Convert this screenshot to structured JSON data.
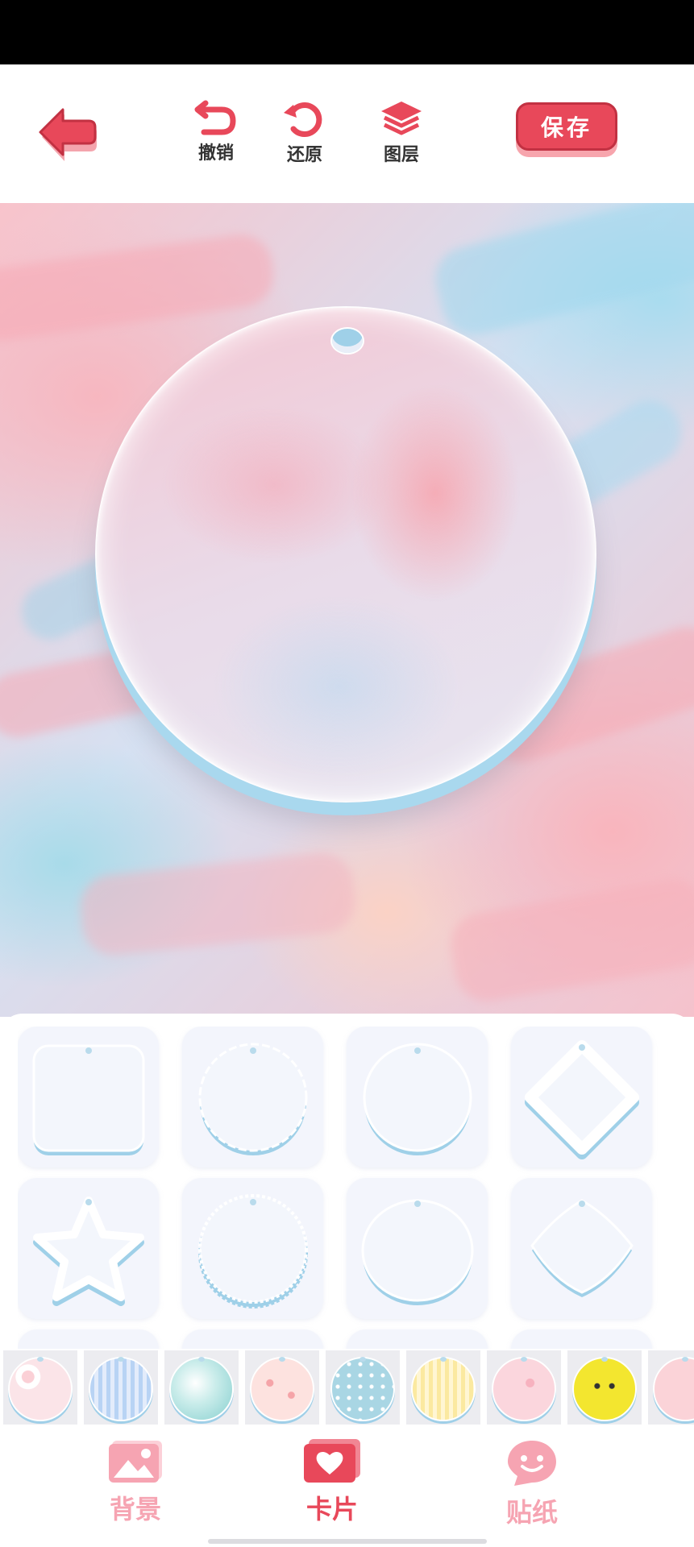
{
  "toolbar": {
    "back_icon": "back-arrow-icon",
    "undo_label": "撤销",
    "redo_label": "还原",
    "layers_label": "图层",
    "save_label": "保存",
    "accent_color": "#e8485a"
  },
  "shape_grid": {
    "shapes": [
      "square",
      "scalloped-circle",
      "circle",
      "diamond",
      "star",
      "serrated-circle",
      "wavy-circle",
      "cloud-diamond"
    ]
  },
  "card_backgrounds": {
    "swatches": [
      "pink-floral",
      "blue-stripes",
      "mint-watercolor",
      "peach-pattern",
      "blue-dots",
      "yellow-stripes",
      "pink-pattern",
      "yellow-face",
      "pink-plain"
    ]
  },
  "tabs": {
    "background_label": "背景",
    "card_label": "卡片",
    "sticker_label": "贴纸",
    "active_tab": "卡片",
    "active_color": "#e8485a",
    "inactive_color": "#f6a4b2"
  }
}
